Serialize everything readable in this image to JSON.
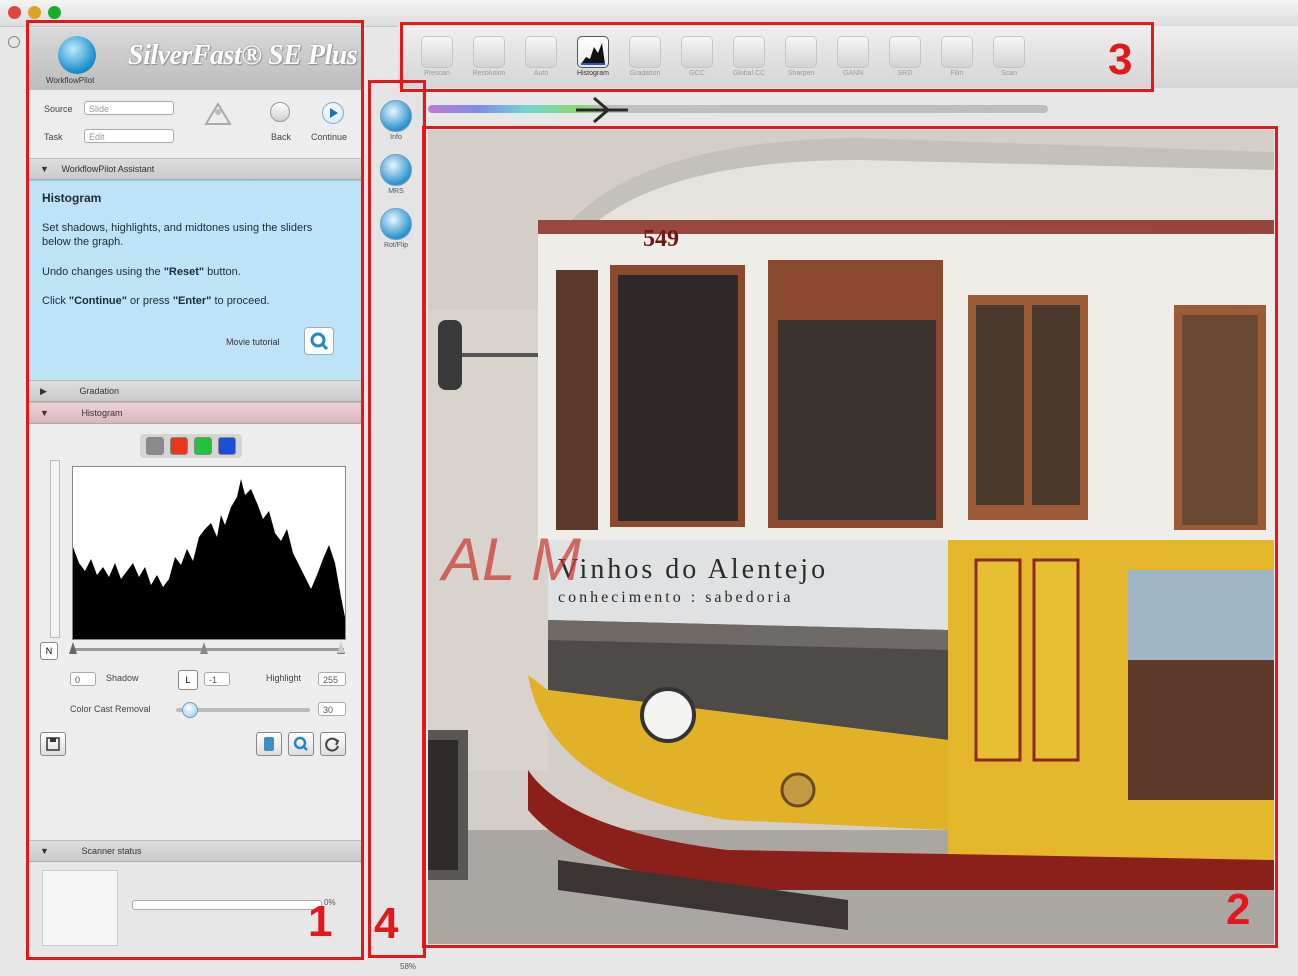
{
  "app": {
    "title": "SilverFast® SE Plus",
    "workflowpilot_label": "WorkflowPilot"
  },
  "wfp_controls": {
    "source_label": "Source",
    "source_value": "Slide",
    "task_label": "Task",
    "task_value": "Edit",
    "back_label": "Back",
    "continue_label": "Continue"
  },
  "assistant": {
    "header": "WorkflowPilot Assistant",
    "title": "Histogram",
    "line1": "Set shadows, highlights, and midtones using the sliders below the graph.",
    "line2_pre": "Undo changes using the ",
    "line2_em": "\"Reset\"",
    "line2_post": " button.",
    "line3_pre": "Click ",
    "line3_em1": "\"Continue\"",
    "line3_mid": " or press ",
    "line3_em2": "\"Enter\"",
    "line3_post": " to proceed.",
    "movie_label": "Movie tutorial"
  },
  "sections": {
    "gradation": "Gradation",
    "histogram": "Histogram",
    "scanner_status": "Scanner status"
  },
  "histogram": {
    "channels": [
      {
        "name": "gray",
        "color": "#8a8a8a"
      },
      {
        "name": "red",
        "color": "#e63a1e"
      },
      {
        "name": "green",
        "color": "#25c13a"
      },
      {
        "name": "blue",
        "color": "#1a4fd6"
      }
    ],
    "shadow_value": "0",
    "shadow_label": "Shadow",
    "midtone_value": "-1",
    "highlight_label": "Highlight",
    "highlight_value": "255",
    "cast_label": "Color Cast Removal",
    "cast_value": "30",
    "cast_level": 0.1
  },
  "scanner_status": {
    "percent": "0%"
  },
  "toolstrip": [
    {
      "icon": "info-icon",
      "label": "Info"
    },
    {
      "icon": "magnifier-clock-icon",
      "label": "MRS"
    },
    {
      "icon": "rotate-flip-icon",
      "label": "Rot/Flip"
    }
  ],
  "top_tools": [
    {
      "icon": "prescan-icon",
      "label": "Prescan"
    },
    {
      "icon": "resolution-icon",
      "label": "Resolution"
    },
    {
      "icon": "auto-icon",
      "label": "Auto"
    },
    {
      "icon": "histogram-icon",
      "label": "Histogram",
      "active": true
    },
    {
      "icon": "gradation-icon",
      "label": "Gradation"
    },
    {
      "icon": "gcc-icon",
      "label": "GCC"
    },
    {
      "icon": "selective-icon",
      "label": "Global CC"
    },
    {
      "icon": "usm-icon",
      "label": "Sharpen"
    },
    {
      "icon": "gann-icon",
      "label": "GANN"
    },
    {
      "icon": "sru-icon",
      "label": "SRD"
    },
    {
      "icon": "film-icon",
      "label": "Film"
    },
    {
      "icon": "scan-icon",
      "label": "Scan"
    }
  ],
  "preview": {
    "tram_number": "549",
    "sign_line1": "Vinhos do Alentejo",
    "sign_line2": "conhecimento : sabedoria",
    "graffiti": "AL M"
  },
  "annotations": [
    "1",
    "2",
    "3",
    "4"
  ],
  "zoom": "58%"
}
